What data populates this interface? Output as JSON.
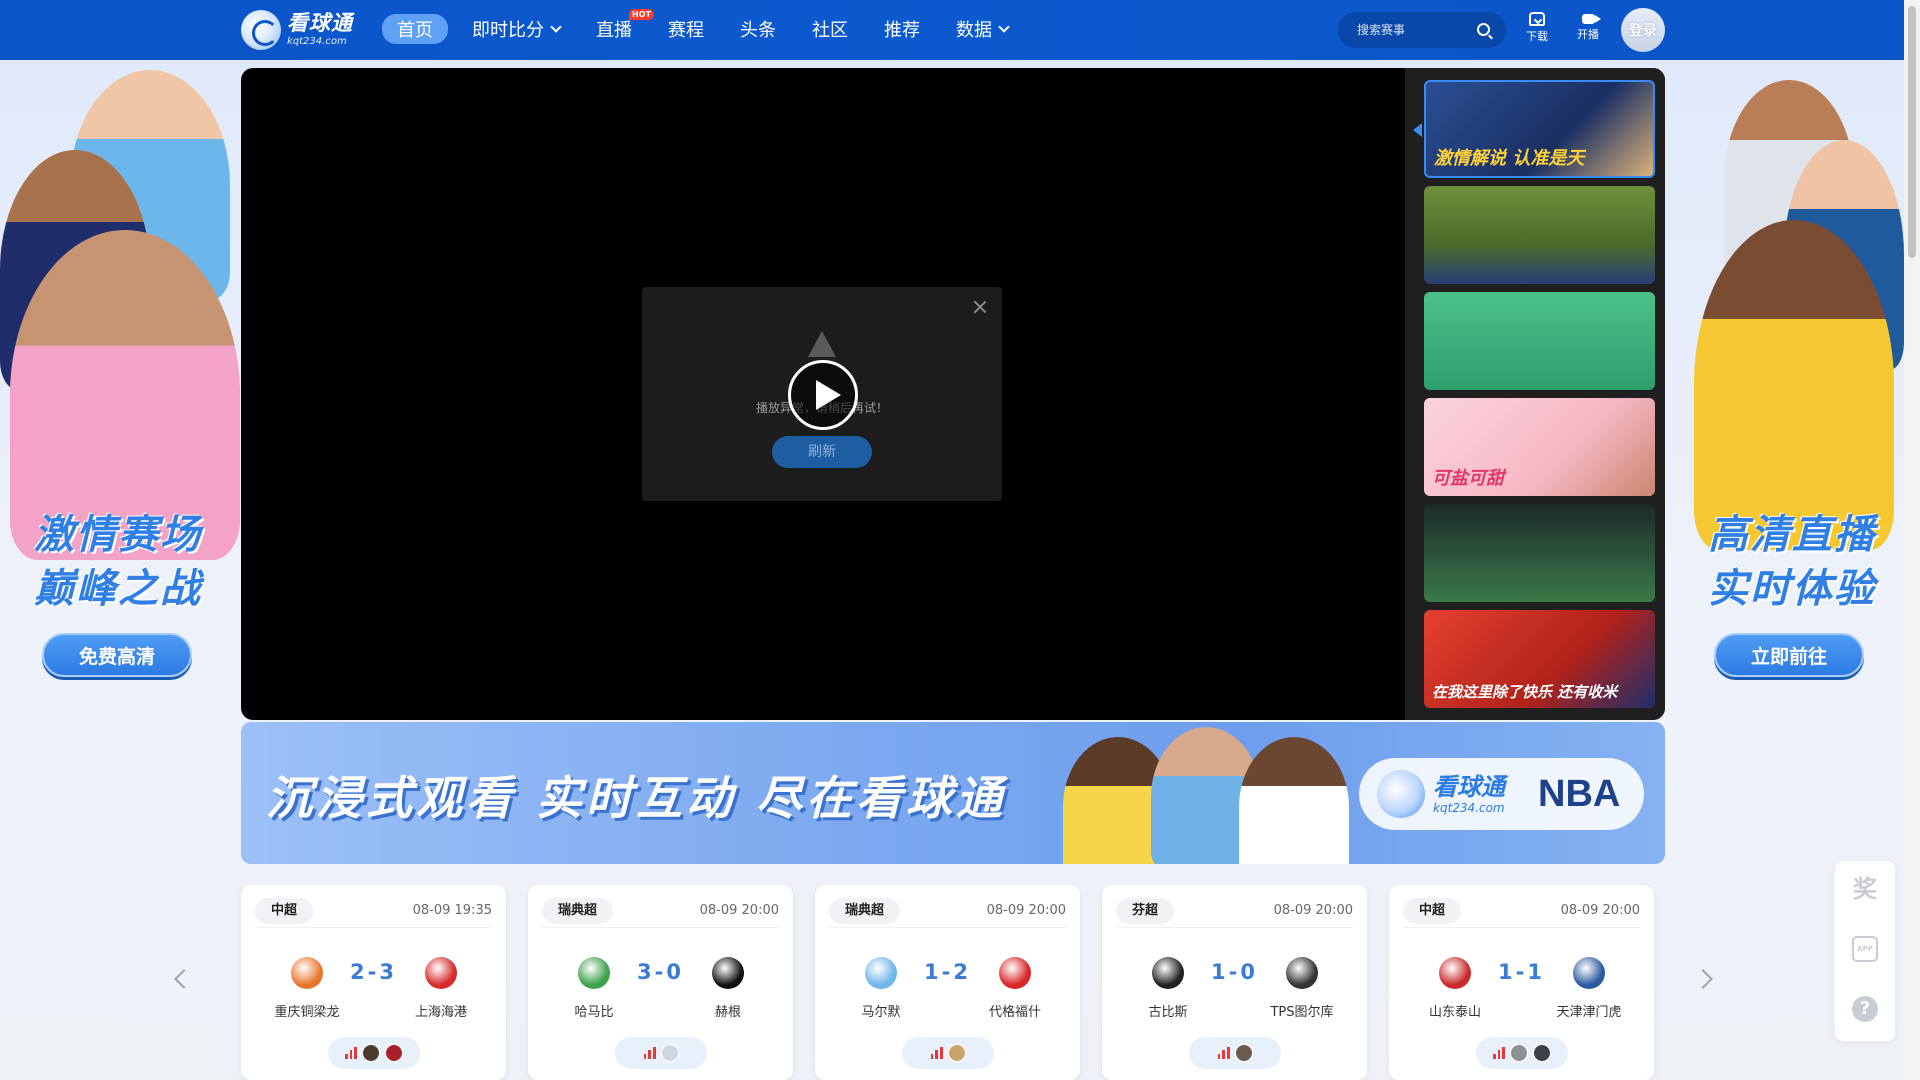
{
  "brand": {
    "name": "看球通",
    "domain": "kqt234.com"
  },
  "nav": {
    "items": [
      {
        "label": "首页"
      },
      {
        "label": "即时比分"
      },
      {
        "label": "直播"
      },
      {
        "label": "赛程"
      },
      {
        "label": "头条"
      },
      {
        "label": "社区"
      },
      {
        "label": "推荐"
      },
      {
        "label": "数据"
      }
    ],
    "hot_badge": "HOT"
  },
  "search": {
    "placeholder": "搜索赛事"
  },
  "tools": {
    "download_label": "下载",
    "broadcast_label": "开播"
  },
  "login": {
    "label": "登录"
  },
  "left_ad": {
    "slogan_line1": "激情赛场",
    "slogan_line2": "巅峰之战",
    "button": "免费高清"
  },
  "right_ad": {
    "slogan_line1": "高清直播",
    "slogan_line2": "实时体验",
    "button": "立即前往"
  },
  "player": {
    "error_message": "播放异常，请稍后再试！",
    "refresh_label": "刷新",
    "thumbnails": [
      {
        "caption": "激情解说 认准是天"
      },
      {
        "caption": ""
      },
      {
        "caption": ""
      },
      {
        "caption": "可盐可甜"
      },
      {
        "caption": ""
      },
      {
        "caption": "在我这里除了快乐 还有收米"
      }
    ]
  },
  "banner": {
    "slogan": "沉浸式观看 实时互动 尽在看球通",
    "brand_name": "看球通",
    "brand_domain": "kqt234.com",
    "partner": "NBA"
  },
  "matches": [
    {
      "league": "中超",
      "time": "08-09 19:35",
      "home": "重庆铜梁龙",
      "away": "上海海港",
      "score": "2-3",
      "home_color": "#e8752c",
      "away_color": "#d62a2a"
    },
    {
      "league": "瑞典超",
      "time": "08-09 20:00",
      "home": "哈马比",
      "away": "赫根",
      "score": "3-0",
      "home_color": "#3da24b",
      "away_color": "#111111"
    },
    {
      "league": "瑞典超",
      "time": "08-09 20:00",
      "home": "马尔默",
      "away": "代格福什",
      "score": "1-2",
      "home_color": "#6fb6ea",
      "away_color": "#d8252a"
    },
    {
      "league": "芬超",
      "time": "08-09 20:00",
      "home": "古比斯",
      "away": "TPS图尔库",
      "score": "1-0",
      "home_color": "#222222",
      "away_color": "#333333"
    },
    {
      "league": "中超",
      "time": "08-09 20:00",
      "home": "山东泰山",
      "away": "天津津门虎",
      "score": "1-1",
      "home_color": "#c92a2a",
      "away_color": "#2c5aa0"
    }
  ],
  "float_tools": {
    "prize": "奖",
    "app": "APP",
    "help": "?"
  }
}
